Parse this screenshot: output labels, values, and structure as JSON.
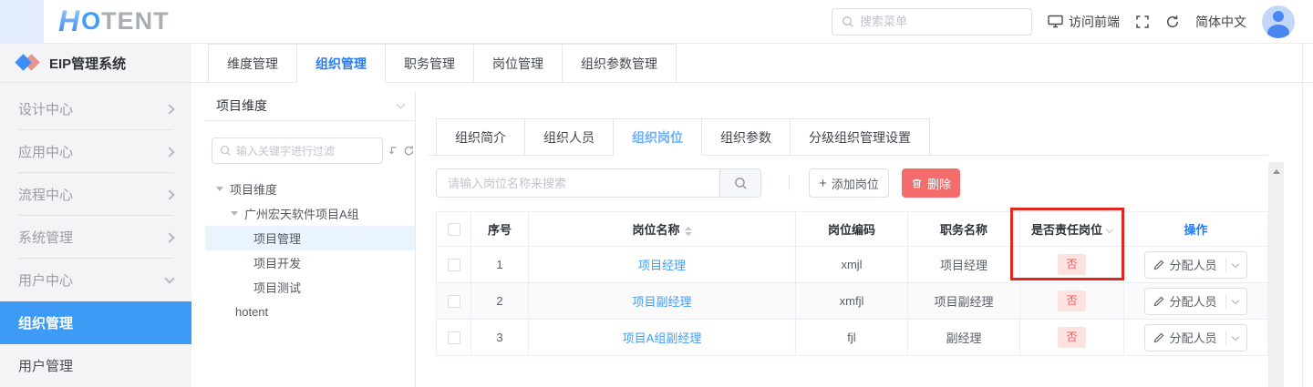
{
  "logo": {
    "part1": "H",
    "part2": "O",
    "part3": "TENT"
  },
  "topbar": {
    "search_placeholder": "搜索菜单",
    "visit_frontend_label": "访问前端",
    "language_label": "简体中文"
  },
  "sidebar": {
    "system_title": "EIP管理系统",
    "items": [
      {
        "label": "设计中心"
      },
      {
        "label": "应用中心"
      },
      {
        "label": "流程中心"
      },
      {
        "label": "系统管理"
      },
      {
        "label": "用户中心"
      },
      {
        "label": "组织管理"
      },
      {
        "label": "用户管理"
      }
    ]
  },
  "main_tabs": [
    {
      "label": "维度管理"
    },
    {
      "label": "组织管理"
    },
    {
      "label": "职务管理"
    },
    {
      "label": "岗位管理"
    },
    {
      "label": "组织参数管理"
    }
  ],
  "tree_panel": {
    "dimension_value": "项目维度",
    "filter_placeholder": "输入关键字进行过滤",
    "nodes": [
      {
        "label": "项目维度"
      },
      {
        "label": "广州宏天软件项目A组"
      },
      {
        "label": "项目管理"
      },
      {
        "label": "项目开发"
      },
      {
        "label": "项目测试"
      },
      {
        "label": "hotent"
      }
    ]
  },
  "detail_tabs": [
    {
      "label": "组织简介"
    },
    {
      "label": "组织人员"
    },
    {
      "label": "组织岗位"
    },
    {
      "label": "组织参数"
    },
    {
      "label": "分级组织管理设置"
    }
  ],
  "toolbar": {
    "search_placeholder": "请输入岗位名称来搜索",
    "add_plus": "+",
    "add_label": "添加岗位",
    "delete_label": "删除"
  },
  "table": {
    "headers": {
      "index": "序号",
      "name": "岗位名称",
      "code": "岗位编码",
      "duty": "职务名称",
      "responsible": "是否责任岗位",
      "actions": "操作"
    },
    "rows": [
      {
        "index": "1",
        "name": "项目经理",
        "code": "xmjl",
        "duty": "项目经理",
        "responsible": "否",
        "action_label": "分配人员"
      },
      {
        "index": "2",
        "name": "项目副经理",
        "code": "xmfjl",
        "duty": "项目副经理",
        "responsible": "否",
        "action_label": "分配人员"
      },
      {
        "index": "3",
        "name": "项目A组副经理",
        "code": "fjl",
        "duty": "副经理",
        "responsible": "否",
        "action_label": "分配人员"
      }
    ]
  },
  "icons": {
    "collapse-menu": "bar-over-rect",
    "search": "magnifier",
    "visit-frontend": "monitor",
    "fullscreen": "corner-brackets",
    "refresh": "circular-arrow",
    "avatar": "person",
    "tree-expanded": "triangle-down",
    "sort": "up-down-carets",
    "add": "plus",
    "delete": "trash",
    "assign": "pen"
  },
  "colors": {
    "primary_blue": "#2a7cf0",
    "active_menu_blue": "#3d9af5",
    "inner_tab_blue": "#6cb1f7",
    "link_blue": "#3f9ef8",
    "danger_red": "#f56c6c",
    "badge_bg": "#fde2e2",
    "annotation_red": "#e3261d"
  }
}
